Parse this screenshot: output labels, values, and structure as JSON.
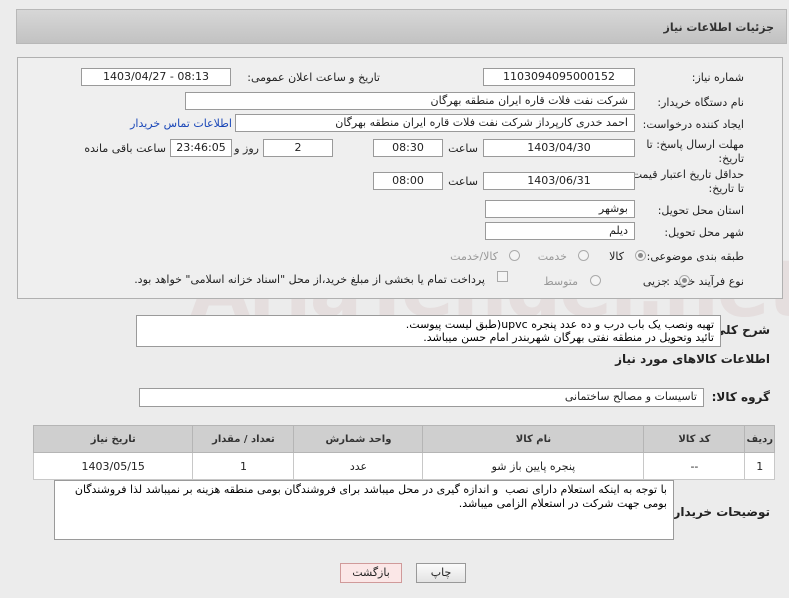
{
  "header": {
    "title": "جزئیات اطلاعات نیاز"
  },
  "fields": {
    "need_number_label": "شماره نیاز:",
    "need_number": "1103094095000152",
    "announce_label": "تاریخ و ساعت اعلان عمومی:",
    "announce_value": "1403/04/27 - 08:13",
    "buyer_org_label": "نام دستگاه خریدار:",
    "buyer_org": "شرکت نفت فلات قاره ایران منطقه بهرگان",
    "requester_label": "ایجاد کننده درخواست:",
    "requester": "احمد خدری کارپرداز شرکت نفت فلات قاره ایران منطقه بهرگان",
    "contact_link": "اطلاعات تماس خریدار",
    "deadline_label": "مهلت ارسال پاسخ: تا تاریخ:",
    "deadline_date": "1403/04/30",
    "time_label": "ساعت",
    "deadline_time": "08:30",
    "days_value": "2",
    "days_label": "روز و",
    "remaining_time": "23:46:05",
    "remaining_label": "ساعت باقی مانده",
    "validity_label": "حداقل تاریخ اعتبار قیمت: تا تاریخ:",
    "validity_date": "1403/06/31",
    "validity_time": "08:00",
    "province_label": "استان محل تحویل:",
    "province": "بوشهر",
    "city_label": "شهر محل تحویل:",
    "city": "دیلم",
    "category_label": "طبقه بندی موضوعی:",
    "category_options": [
      "کالا",
      "خدمت",
      "کالا/خدمت"
    ],
    "process_label": "نوع فرآیند خرید :",
    "process_options": [
      "جزیی",
      "متوسط"
    ],
    "payment_note": "پرداخت تمام یا بخشی از مبلغ خرید،از محل \"اسناد خزانه اسلامی\" خواهد بود."
  },
  "description": {
    "label": "شرح کلی نیاز:",
    "text": "تهیه ونصب یک باب درب و ده عدد پنجره upvc(طبق لیست پیوست.\nتائید وتحویل در منطقه نفتی بهرگان شهربندر امام حسن میباشد."
  },
  "goods": {
    "section_title": "اطلاعات کالاهای مورد نیاز",
    "group_label": "گروه کالا:",
    "group_value": "تاسیسات و مصالح ساختمانی",
    "columns": [
      "ردیف",
      "کد کالا",
      "نام کالا",
      "واحد شمارش",
      "تعداد / مقدار",
      "تاریخ نیاز"
    ],
    "rows": [
      [
        "1",
        "--",
        "پنجره پایین باز شو",
        "عدد",
        "1",
        "1403/05/15"
      ]
    ]
  },
  "buyer_notes": {
    "label": "توضیحات خریدار:",
    "text": "با توجه به اینکه استعلام دارای نصب  و اندازه گیری در محل میباشد برای فروشندگان بومی منطقه هزینه بر نمیباشد لذا فروشندگان بومی جهت شرکت در استعلام الزامی میباشد."
  },
  "buttons": {
    "print": "چاپ",
    "back": "بازگشت"
  },
  "watermark": "AriaTender.net",
  "colors": {
    "link": "#1a47b8",
    "back_button": "#fbe7e7"
  }
}
